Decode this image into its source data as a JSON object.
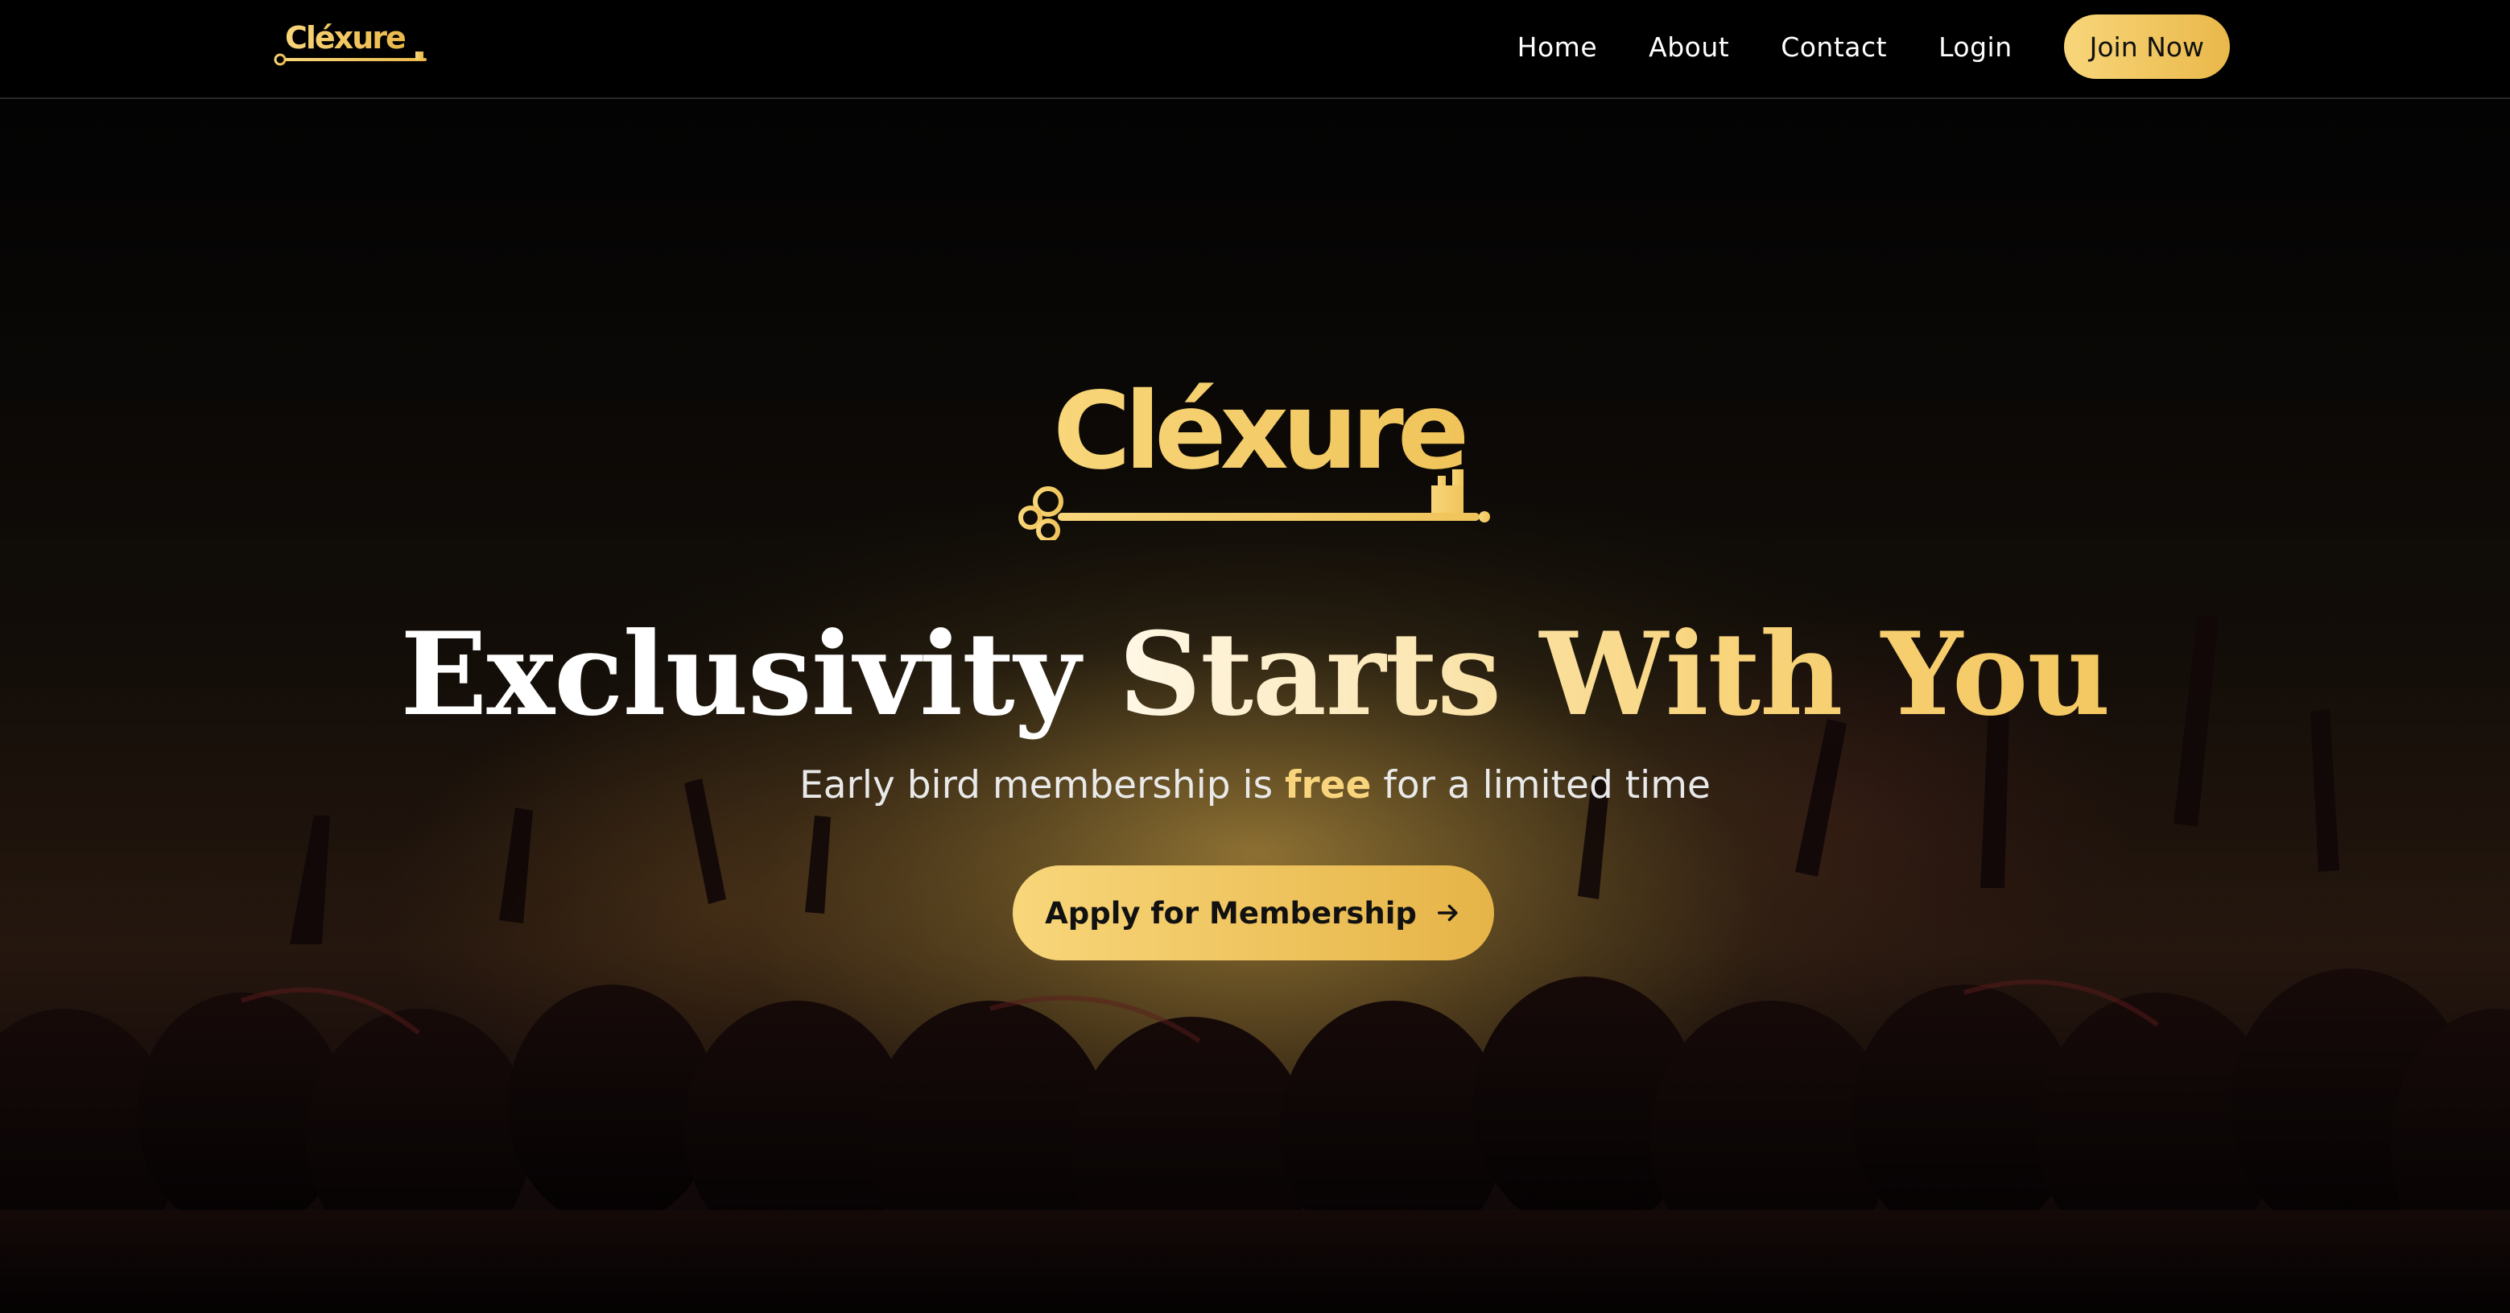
{
  "brand": {
    "name": "Cléxure",
    "accent_color": "#f4c760",
    "accent_light": "#fbe7b4"
  },
  "nav": {
    "links": [
      {
        "label": "Home"
      },
      {
        "label": "About"
      },
      {
        "label": "Contact"
      },
      {
        "label": "Login"
      }
    ],
    "cta_label": "Join Now"
  },
  "hero": {
    "title_white": "Exclusivity ",
    "title_gold": "Starts With You",
    "subtitle_before": "Early bird membership is ",
    "subtitle_highlight": "free",
    "subtitle_after": " for a limited time",
    "cta_label": "Apply for Membership",
    "cta_icon": "arrow-right-icon",
    "background": "concert-crowd-photo"
  }
}
